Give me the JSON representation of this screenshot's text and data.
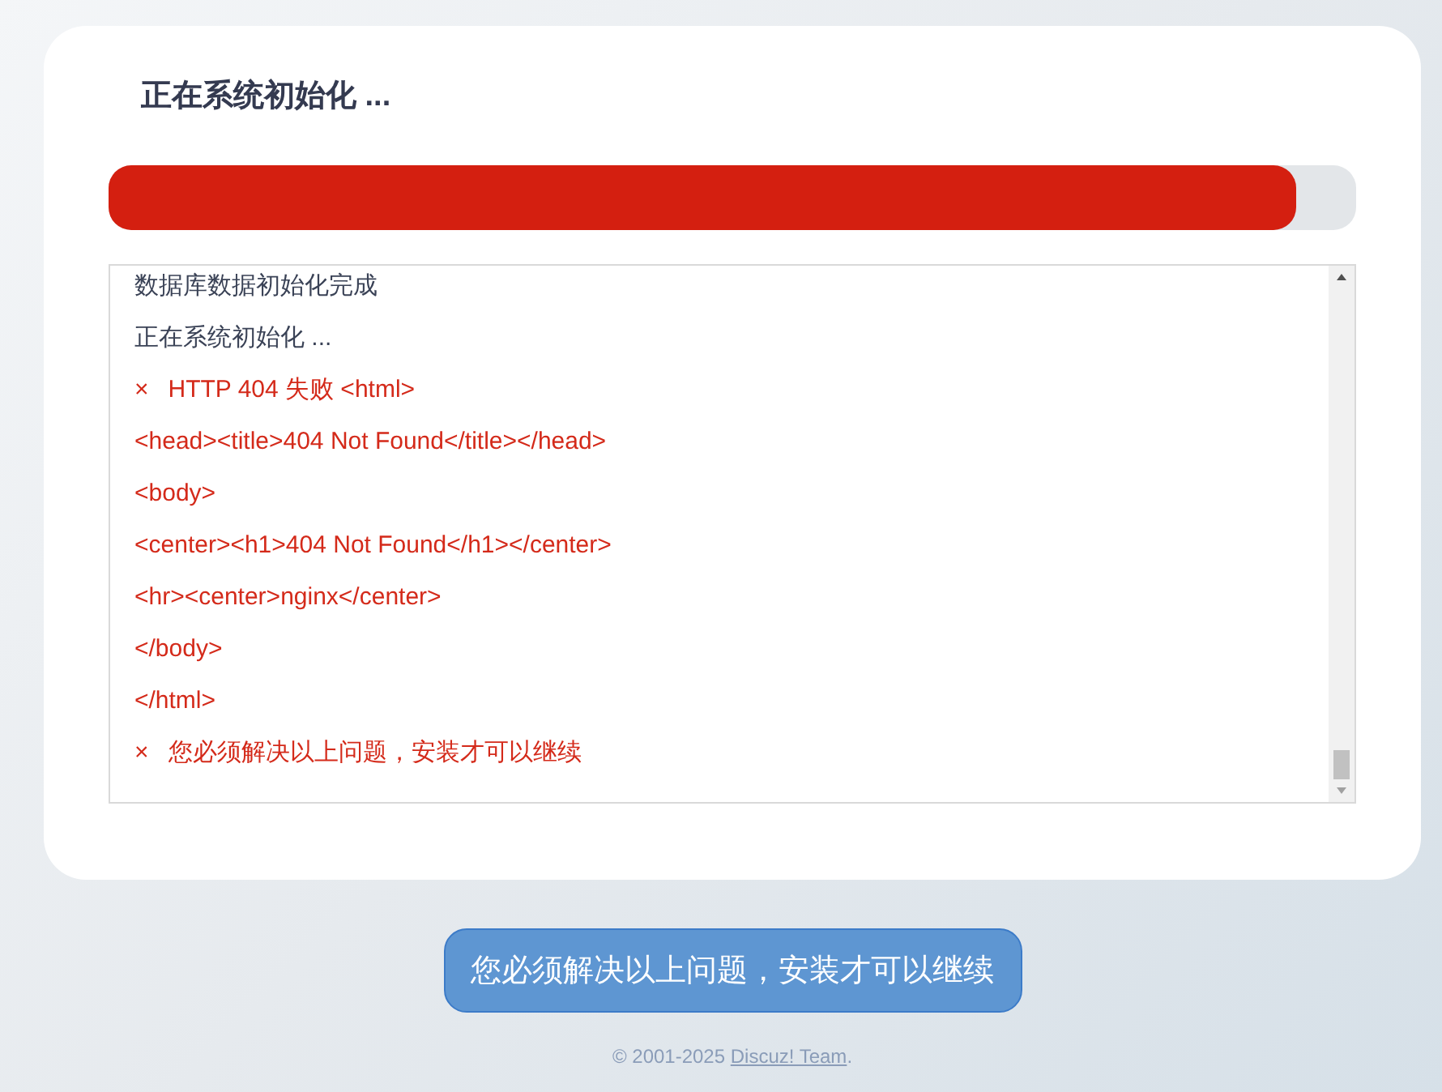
{
  "panel": {
    "title": "正在系统初始化 ...",
    "progress": {
      "level": 0.952
    },
    "log": [
      {
        "kind": "info",
        "text": "数据库数据初始化完成"
      },
      {
        "kind": "info",
        "text": "正在系统初始化 ..."
      },
      {
        "kind": "error",
        "mark": "×",
        "text": "HTTP 404 失败 <html>"
      },
      {
        "kind": "error",
        "text": "<head><title>404 Not Found</title></head>"
      },
      {
        "kind": "error",
        "text": "<body>"
      },
      {
        "kind": "error",
        "text": "<center><h1>404 Not Found</h1></center>"
      },
      {
        "kind": "error",
        "text": "<hr><center>nginx</center>"
      },
      {
        "kind": "error",
        "text": "</body>"
      },
      {
        "kind": "error",
        "text": "</html>"
      },
      {
        "kind": "error",
        "mark": "×",
        "text": "您必须解决以上问题，安装才可以继续"
      }
    ]
  },
  "action_button": {
    "label": "您必须解决以上问题，安装才可以继续"
  },
  "footer": {
    "text": "© 2001-2025 ",
    "link": "Discuz! Team",
    "suffix": "."
  }
}
